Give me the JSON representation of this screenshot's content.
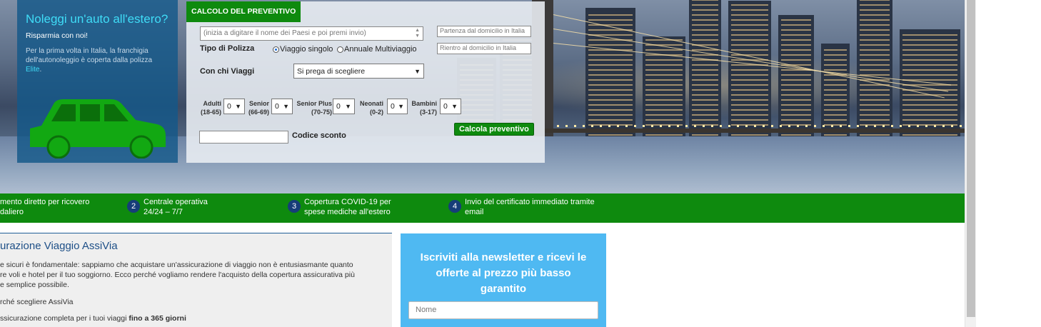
{
  "promo": {
    "title": "Noleggi un'auto all'estero?",
    "subtitle": "Risparmia con noi!",
    "desc_prefix": "Per la prima volta in Italia, la franchigia dell'autonoleggio è coperta dalla polizza ",
    "desc_highlight": "Elite",
    "desc_suffix": "."
  },
  "quote": {
    "title": "CALCOLO DEL PREVENTIVO",
    "country_placeholder": "(inizia a digitare il nome dei Paesi e poi premi invio)",
    "departure_placeholder": "Partenza dal domicilio in Italia",
    "return_placeholder": "Rientro al domicilio in Italia",
    "policy_label": "Tipo di Polizza",
    "policy_options": [
      "Viaggio singolo",
      "Annuale Multiviaggio"
    ],
    "policy_selected": "Viaggio singolo",
    "companion_label": "Con chi Viaggi",
    "companion_value": "Si prega di scegliere",
    "travelers": [
      {
        "label": "Adulti",
        "range": "(18-65)",
        "value": "0"
      },
      {
        "label": "Senior",
        "range": "(66-69)",
        "value": "0"
      },
      {
        "label": "Senior Plus",
        "range": "(70-75)",
        "value": "0"
      },
      {
        "label": "Neonati",
        "range": "(0-2)",
        "value": "0"
      },
      {
        "label": "Bambini",
        "range": "(3-17)",
        "value": "0"
      }
    ],
    "discount_label": "Codice sconto",
    "discount_value": "",
    "submit_label": "Calcola preventivo"
  },
  "features": [
    {
      "num": "",
      "line1": "mento diretto per ricovero",
      "line2": "daliero"
    },
    {
      "num": "2",
      "line1": "Centrale operativa",
      "line2": "24/24 – 7/7"
    },
    {
      "num": "3",
      "line1": "Copertura COVID-19 per",
      "line2": "spese mediche all'estero"
    },
    {
      "num": "4",
      "line1": "Invio del certificato immediato tramite",
      "line2": "email"
    }
  ],
  "content": {
    "heading": "urazione Viaggio AssiVia",
    "para1_line1": "e sicuri è fondamentale: sappiamo che acquistare un'assicurazione di viaggio non è entusiasmante quanto",
    "para1_line2": "re voli e hotel per il tuo soggiorno. Ecco perché vogliamo rendere l'acquisto della copertura assicurativa più",
    "para1_line3": "e semplice possibile.",
    "para2": "rché scegliere AssiVia",
    "para3_prefix": "ssicurazione completa per i tuoi viaggi ",
    "para3_bold": "fino a 365 giorni"
  },
  "newsletter": {
    "heading": "Iscriviti alla newsletter e ricevi le offerte al prezzo più basso garantito",
    "name_placeholder": "Nome"
  },
  "colors": {
    "brand_green": "#0e8a0e",
    "promo_blue": "#135889",
    "accent_cyan": "#3fdcf7",
    "newsletter_blue": "#4fb9f2",
    "heading_blue": "#1d4f87"
  }
}
